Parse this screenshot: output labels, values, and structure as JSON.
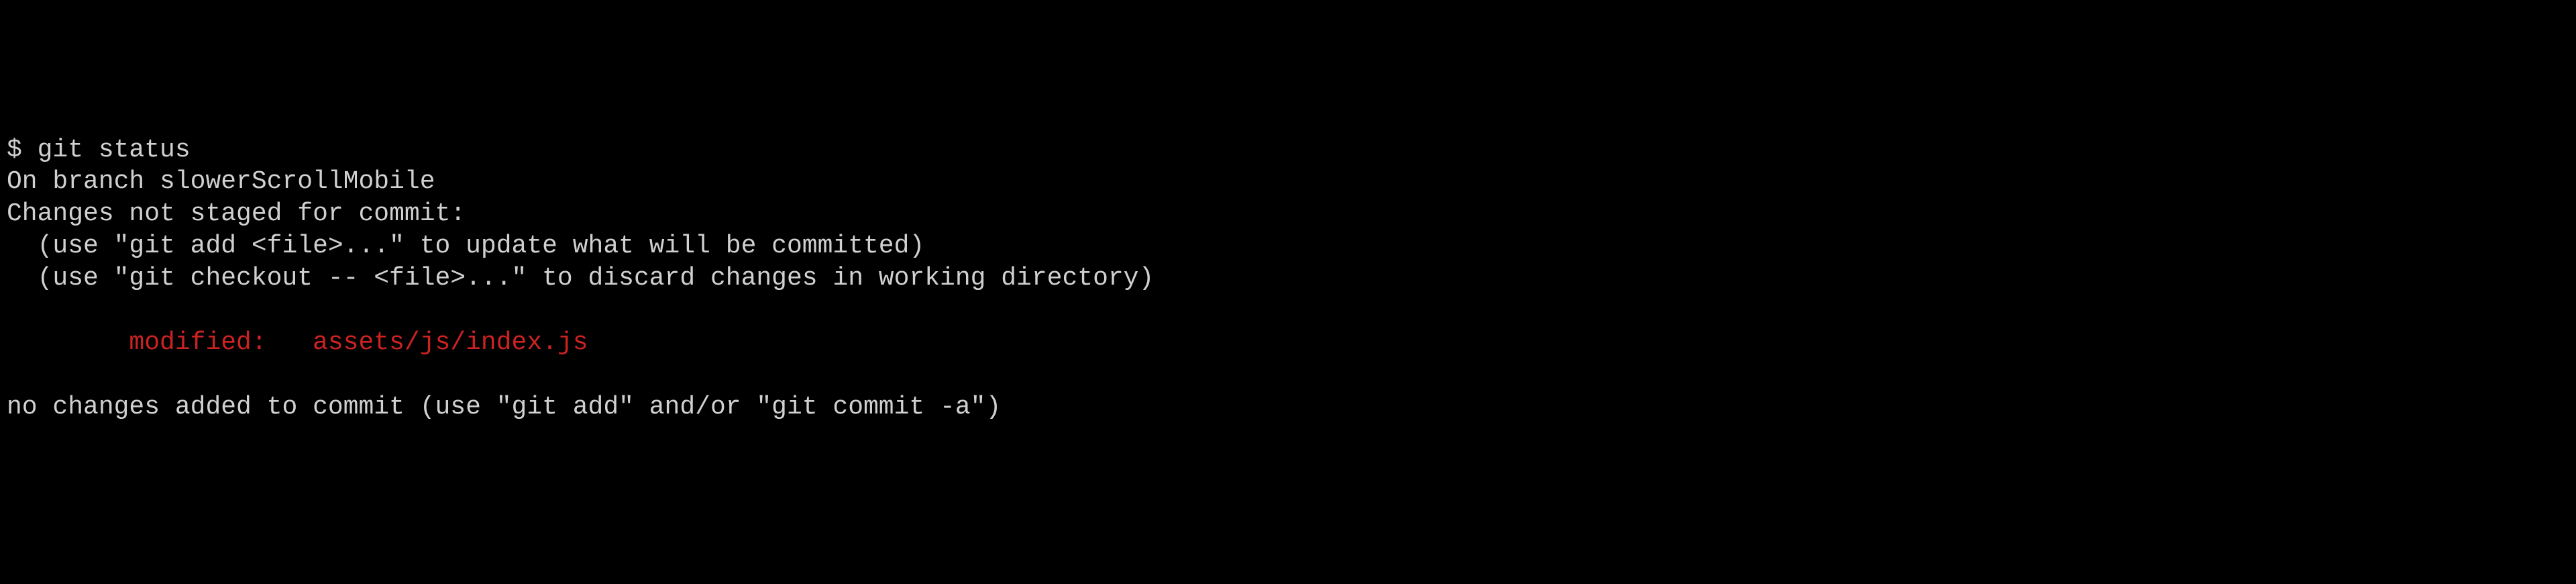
{
  "terminal": {
    "prompt": "$ ",
    "command": "git status",
    "output": {
      "branch_line": "On branch slowerScrollMobile",
      "not_staged_header": "Changes not staged for commit:",
      "hint_add": "  (use \"git add <file>...\" to update what will be committed)",
      "hint_checkout": "  (use \"git checkout -- <file>...\" to discard changes in working directory)",
      "modified_entry": "        modified:   assets/js/index.js",
      "no_changes": "no changes added to commit (use \"git add\" and/or \"git commit -a\")"
    }
  }
}
